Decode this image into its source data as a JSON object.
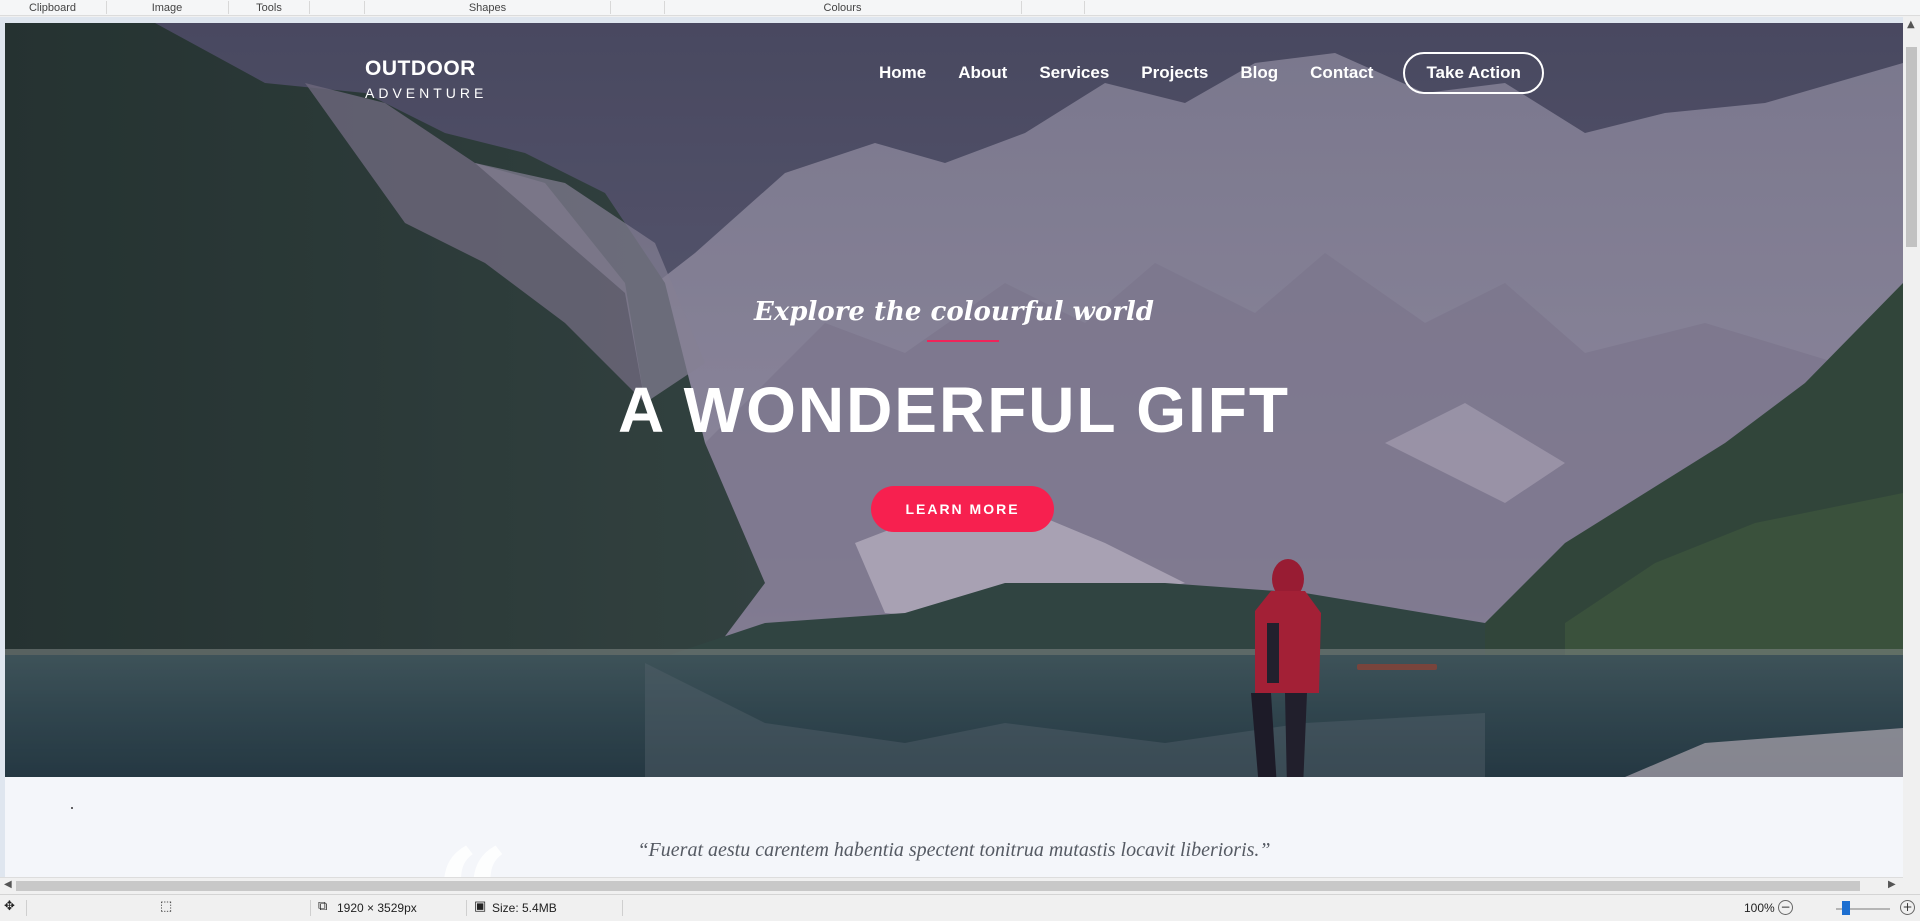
{
  "ribbon": {
    "groups": [
      "Clipboard",
      "Image",
      "Tools",
      "Shapes",
      "Colours"
    ]
  },
  "site": {
    "brand_line1": "OUTDOOR",
    "brand_line2": "ADVENTURE",
    "nav": [
      "Home",
      "About",
      "Services",
      "Projects",
      "Blog",
      "Contact"
    ],
    "nav_cta": "Take Action",
    "hero_subtitle": "Explore the colourful world",
    "hero_title": "A WONDERFUL GIFT",
    "hero_button": "LEARN MORE",
    "quote": "“Fuerat aestu carentem habentia spectent tonitrua mutastis locavit liberioris.”",
    "accent_color": "#f7204f"
  },
  "status": {
    "dimensions": "1920 × 3529px",
    "size": "Size: 5.4MB",
    "zoom": "100%"
  },
  "icons": {
    "move": "move-icon",
    "selection": "selection-icon",
    "dimensions": "image-dimensions-icon",
    "size": "disk-icon",
    "zoom_out": "zoom-out-icon",
    "zoom_in": "zoom-in-icon"
  }
}
